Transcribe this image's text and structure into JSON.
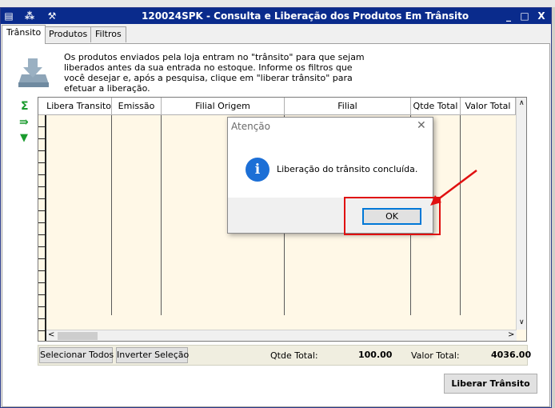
{
  "window": {
    "title": "120024SPK - Consulta e Liberação dos Produtos Em Trânsito",
    "minimize": "_",
    "maximize": "□",
    "close": "X"
  },
  "tabs": [
    {
      "label": "Trânsito",
      "active": true
    },
    {
      "label": "Produtos",
      "active": false
    },
    {
      "label": "Filtros",
      "active": false
    }
  ],
  "info_text": "Os produtos enviados pela loja entram no \"trânsito\" para que sejam liberados antes da sua entrada no estoque. Informe os filtros que você desejar e, após a pesquisa, clique em \"liberar trânsito\" para efetuar a liberação.",
  "grid": {
    "columns": [
      "Libera Transito",
      "Emissão",
      "Filial Origem",
      "Filial",
      "Qtde Total",
      "Valor Total"
    ]
  },
  "footer": {
    "select_all": "Selecionar Todos",
    "invert_selection": "Inverter Seleção",
    "qtde_label": "Qtde Total:",
    "qtde_value": "100.00",
    "valor_label": "Valor Total:",
    "valor_value": "4036.00",
    "liberar_button": "Liberar Trânsito"
  },
  "dialog": {
    "title": "Atenção",
    "message": "Liberação do trânsito concluída.",
    "ok_label": "OK",
    "close": "✕",
    "info_glyph": "i"
  },
  "colors": {
    "titlebar": "#0a2b8c",
    "grid_bg": "#fff8e7",
    "annotation_red": "#e01010",
    "info_icon": "#1c6fd6"
  }
}
